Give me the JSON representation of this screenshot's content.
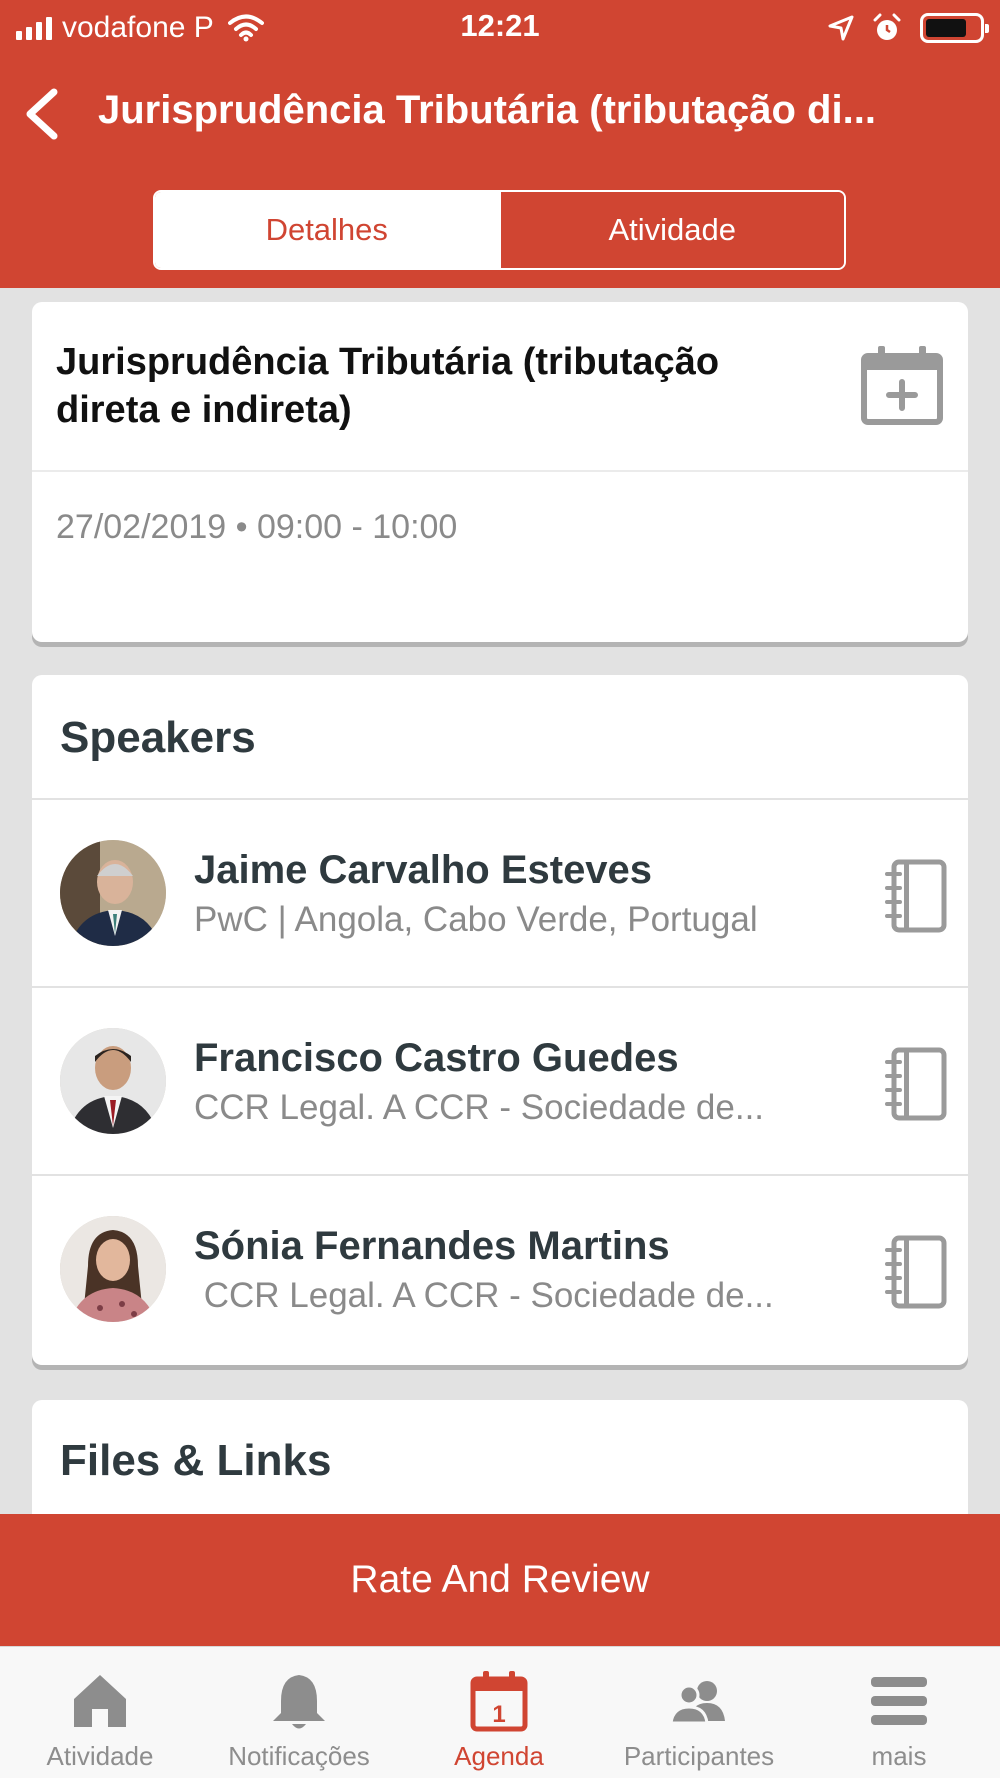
{
  "status_bar": {
    "carrier": "vodafone P",
    "time": "12:21"
  },
  "nav": {
    "title": "Jurisprudência Tributária (tributação di..."
  },
  "segments": {
    "details": "Detalhes",
    "activity": "Atividade"
  },
  "event": {
    "title": "Jurisprudência Tributária (tributação direta e indireta)",
    "datetime": "27/02/2019 • 09:00 - 10:00"
  },
  "speakers": {
    "title": "Speakers",
    "items": [
      {
        "name": "Jaime Carvalho Esteves",
        "org": "PwC | Angola, Cabo Verde, Portugal"
      },
      {
        "name": "Francisco Castro Guedes",
        "org": "CCR Legal. A CCR - Sociedade de..."
      },
      {
        "name": "Sónia Fernandes Martins",
        "org": " CCR Legal. A CCR - Sociedade de..."
      }
    ]
  },
  "files": {
    "title": "Files & Links"
  },
  "rate_button": "Rate And Review",
  "tabs": [
    {
      "label": "Atividade",
      "icon": "home-icon"
    },
    {
      "label": "Notificações",
      "icon": "bell-icon"
    },
    {
      "label": "Agenda",
      "icon": "calendar-icon",
      "active": true
    },
    {
      "label": "Participantes",
      "icon": "people-icon"
    },
    {
      "label": "mais",
      "icon": "menu-icon"
    }
  ],
  "colors": {
    "accent": "#d04532",
    "background": "#e2e2e2",
    "text_dark": "#2f3a3f",
    "text_muted": "#8a8a8a"
  }
}
